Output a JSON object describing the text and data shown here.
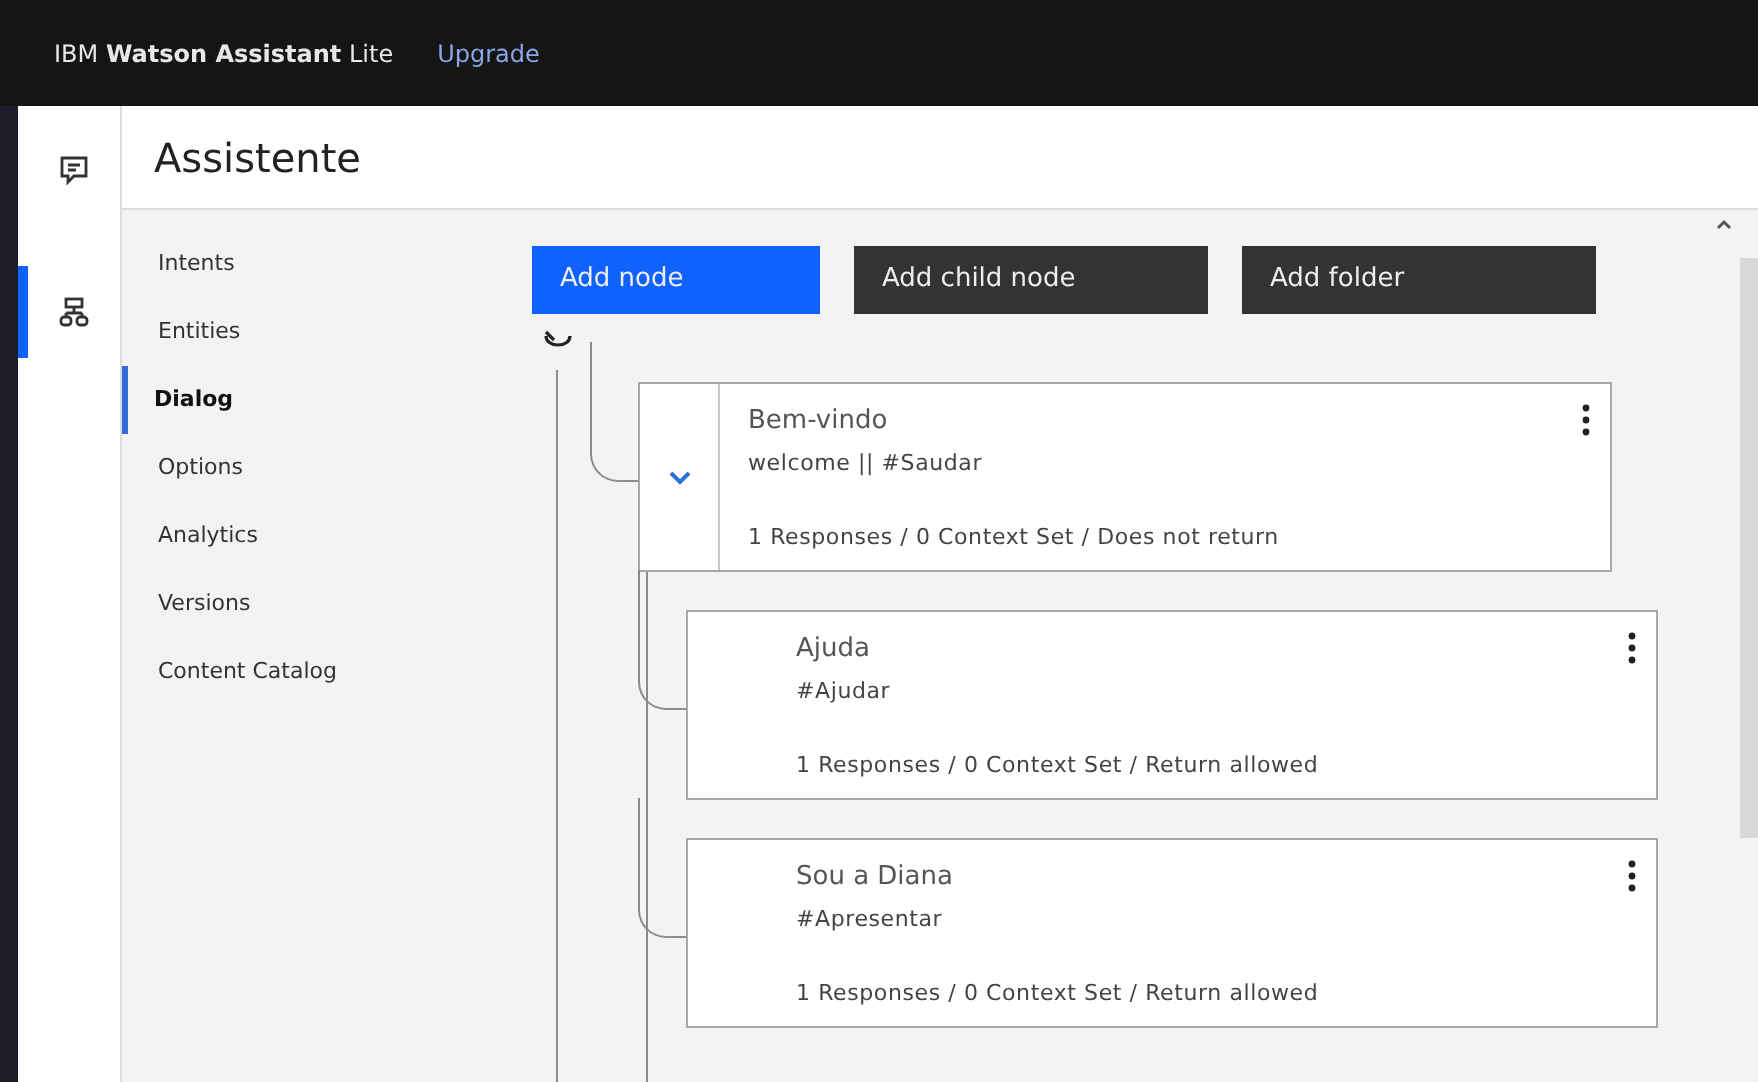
{
  "topbar": {
    "brand_prefix": "IBM",
    "brand_name": "Watson Assistant",
    "brand_plan": "Lite",
    "upgrade_link": "Upgrade"
  },
  "rail": [
    {
      "kind": "chat",
      "selected": false
    },
    {
      "kind": "tree",
      "selected": true
    }
  ],
  "page_title": "Assistente",
  "nav": [
    {
      "label": "Intents",
      "selected": false
    },
    {
      "label": "Entities",
      "selected": false
    },
    {
      "label": "Dialog",
      "selected": true
    },
    {
      "label": "Options",
      "selected": false
    },
    {
      "label": "Analytics",
      "selected": false
    },
    {
      "label": "Versions",
      "selected": false
    },
    {
      "label": "Content Catalog",
      "selected": false
    }
  ],
  "actions": [
    {
      "label": "Add node",
      "primary": true
    },
    {
      "label": "Add child node",
      "primary": false
    },
    {
      "label": "Add folder",
      "primary": false
    }
  ],
  "nodes": [
    {
      "title": "Bem-vindo",
      "condition": "welcome || #Saudar",
      "summary": "1 Responses / 0 Context Set / Does not return",
      "expanded": true,
      "children": [
        {
          "title": "Ajuda",
          "condition": "#Ajudar",
          "summary": "1 Responses / 0 Context Set / Return allowed"
        },
        {
          "title": "Sou a Diana",
          "condition": "#Apresentar",
          "summary": "1 Responses / 0 Context Set / Return allowed"
        }
      ]
    }
  ]
}
